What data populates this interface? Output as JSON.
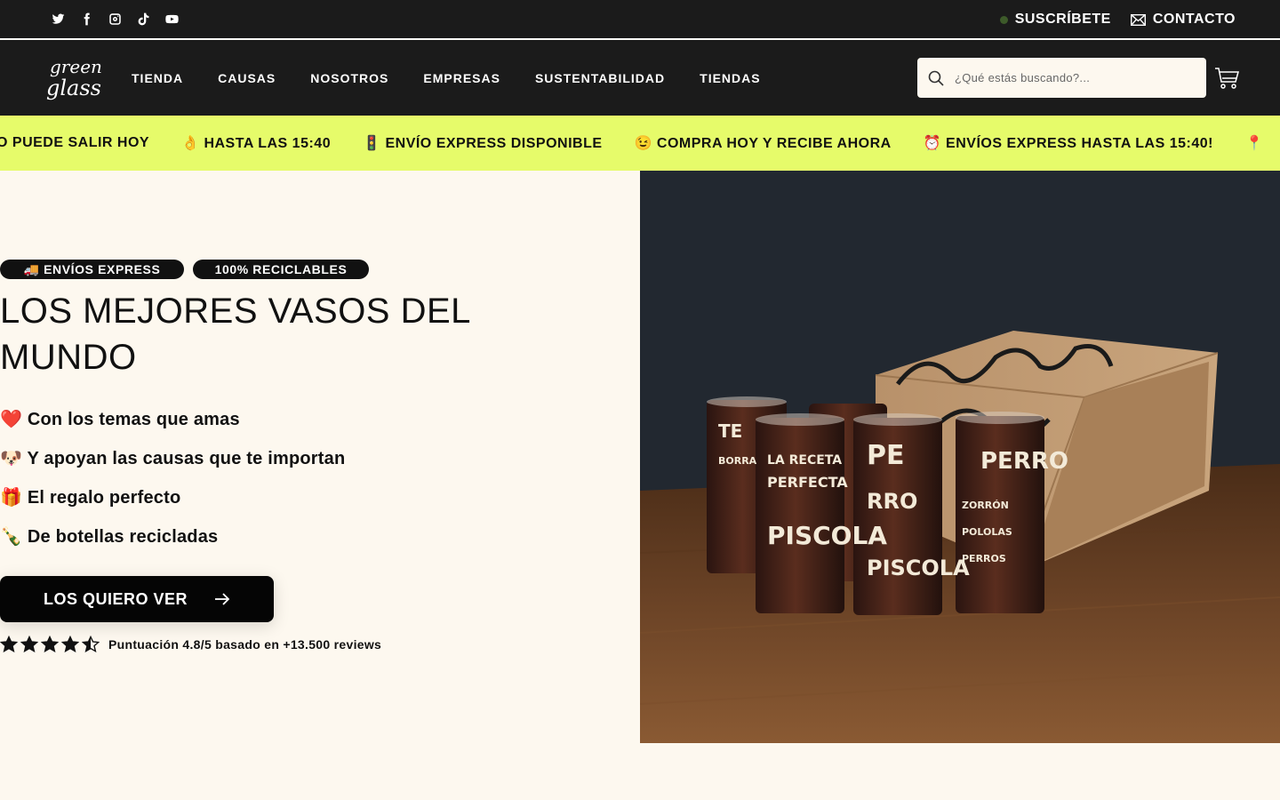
{
  "topbar": {
    "social_icons": [
      "twitter-icon",
      "facebook-icon",
      "instagram-icon",
      "tiktok-icon",
      "youtube-icon"
    ],
    "subscribe_label": "SUSCRÍBETE",
    "contact_label": "CONTACTO"
  },
  "header": {
    "logo_line1": "green",
    "logo_line2": "glass",
    "nav": [
      "TIENDA",
      "CAUSAS",
      "NOSOTROS",
      "EMPRESAS",
      "SUSTENTABILIDAD",
      "TIENDAS"
    ],
    "search_placeholder": "¿Qué estás buscando?..."
  },
  "marquee": {
    "items": [
      "O PUEDE SALIR HOY",
      "👌 HASTA LAS 15:40",
      "🚦 ENVÍO EXPRESS DISPONIBLE",
      "😉 COMPRA HOY Y RECIBE AHORA",
      "⏰ ENVÍOS EXPRESS HASTA LAS 15:40!",
      "📍"
    ]
  },
  "hero": {
    "badges": [
      "🚚 ENVÍOS EXPRESS",
      "100% RECICLABLES"
    ],
    "headline": "LOS MEJORES VASOS DEL MUNDO",
    "benefits": [
      "❤️ Con los temas que amas",
      "🐶 Y apoyan las causas que te importan",
      "🎁 El regalo perfecto",
      "🍾 De botellas recicladas"
    ],
    "cta_label": "LOS QUIERO VER",
    "rating": 4.5,
    "rating_text": "Puntuación 4.8/5 basado en +13.500 reviews"
  },
  "colors": {
    "dark": "#1b1b1b",
    "marquee_bg": "#e6fb6a",
    "page_bg": "#fdf8ef"
  }
}
